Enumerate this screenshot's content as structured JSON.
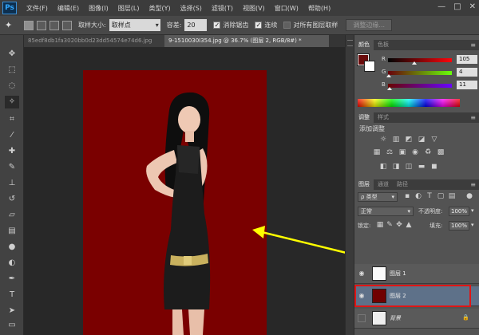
{
  "app": {
    "logo": "Ps"
  },
  "menu": [
    "文件(F)",
    "编辑(E)",
    "图像(I)",
    "图层(L)",
    "类型(Y)",
    "选择(S)",
    "滤镜(T)",
    "视图(V)",
    "窗口(W)",
    "帮助(H)"
  ],
  "window_controls": [
    "—",
    "□",
    "✕"
  ],
  "options": {
    "sample_size_label": "取样大小:",
    "sample_size_value": "取样点",
    "tolerance_label": "容差:",
    "tolerance_value": "20",
    "antialias_label": "消除锯齿",
    "antialias_checked": true,
    "contiguous_label": "连续",
    "contiguous_checked": true,
    "all_layers_label": "对所有图层取样",
    "all_layers_checked": false,
    "refine_edge_label": "调整边缘..."
  },
  "documents": [
    {
      "name": "85edf8db1fa3020bb0d23dd54574e74d6.jpg",
      "active": false
    },
    {
      "name": "9-1510030I354.jpg @ 36.7% (图层 2, RGB/8#) *",
      "active": true
    }
  ],
  "canvas": {
    "bg_color": "#7a0000"
  },
  "color_panel": {
    "tabs": [
      "颜色",
      "色板"
    ],
    "r_label": "R",
    "g_label": "G",
    "b_label": "B",
    "r": "105",
    "g": "4",
    "b": "11",
    "foreground": "#690b0b",
    "background": "#ffffff"
  },
  "adjustments_panel": {
    "tabs": [
      "调整",
      "样式"
    ],
    "title": "添加调整"
  },
  "layers_panel": {
    "tabs": [
      "图层",
      "通道",
      "路径"
    ],
    "filter_label": "ρ 类型",
    "blend_mode": "正常",
    "opacity_label": "不透明度:",
    "opacity_value": "100%",
    "lock_label": "锁定:",
    "fill_label": "填充:",
    "fill_value": "100%",
    "layers": [
      {
        "name": "图层 1",
        "visible": true,
        "selected": false,
        "thumb": "girl"
      },
      {
        "name": "图层 2",
        "visible": true,
        "selected": true,
        "thumb": "red"
      },
      {
        "name": "背景",
        "visible": false,
        "selected": false,
        "thumb": "bg",
        "locked": true
      }
    ]
  },
  "annotation": {
    "arrow_color": "#ffff00",
    "highlight_color": "#e01515"
  }
}
